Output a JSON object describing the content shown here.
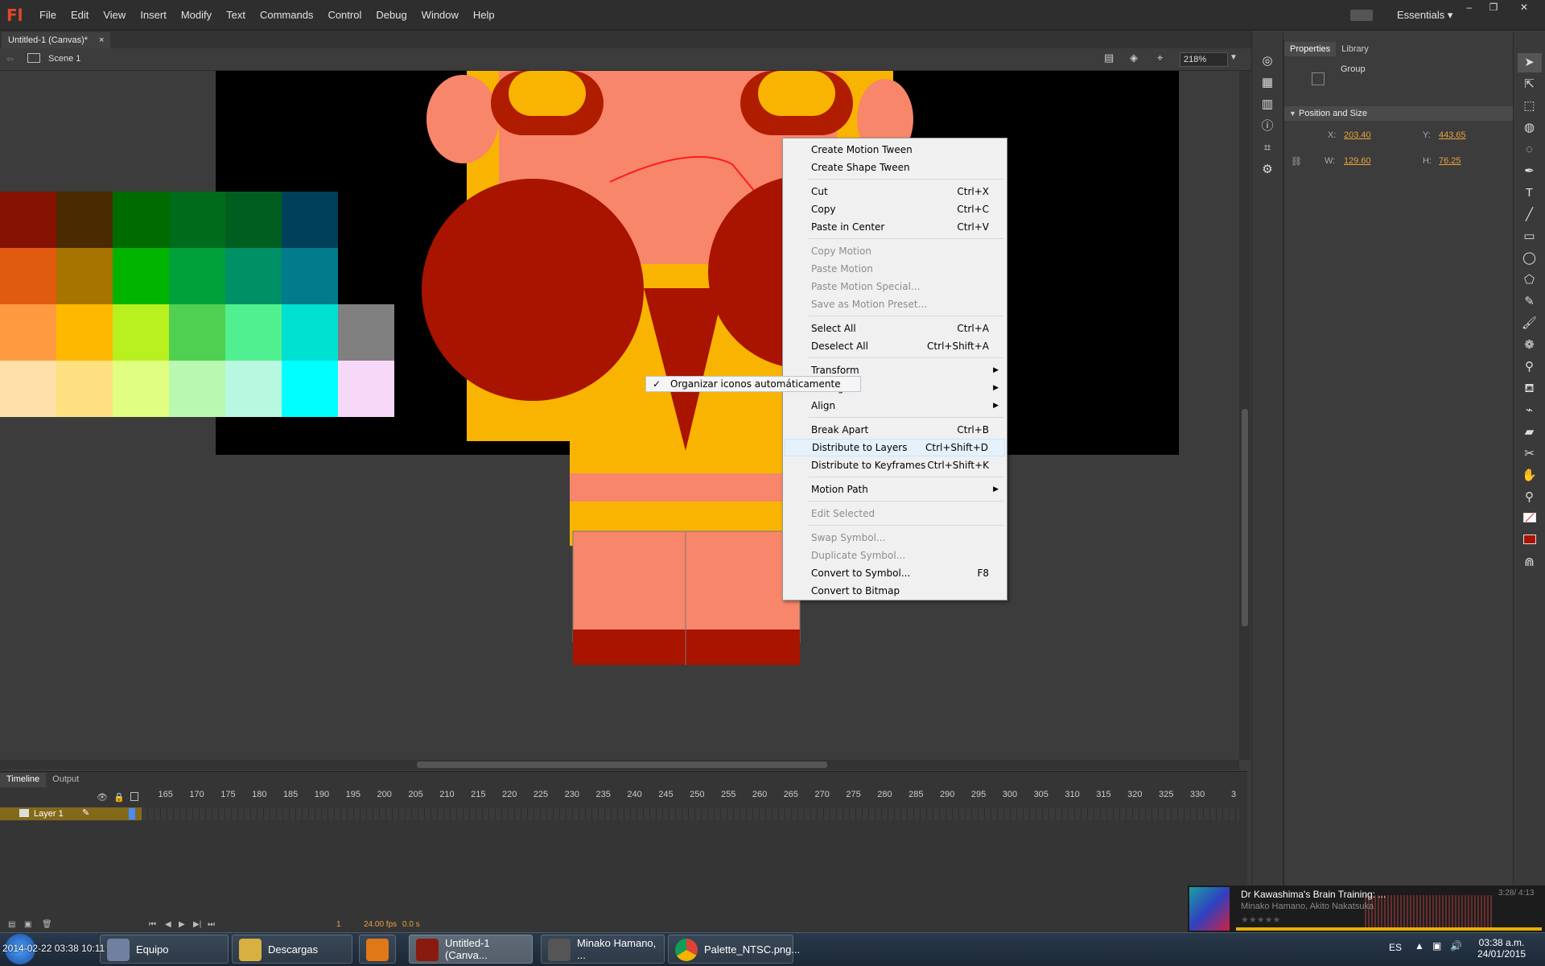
{
  "app": {
    "logo": "Fl",
    "menu": [
      "File",
      "Edit",
      "View",
      "Insert",
      "Modify",
      "Text",
      "Commands",
      "Control",
      "Debug",
      "Window",
      "Help"
    ],
    "workspace": "Essentials",
    "window_buttons": [
      "–",
      "❐",
      "✕"
    ]
  },
  "document": {
    "tab_title": "Untitled-1 (Canvas)*",
    "tab_close": "×",
    "scene": "Scene 1",
    "zoom": "218%"
  },
  "properties": {
    "tabs": [
      "Properties",
      "Library"
    ],
    "instance_type": "Group",
    "section": "Position and Size",
    "x_label": "X:",
    "x_value": "203.40",
    "y_label": "Y:",
    "y_value": "443.65",
    "w_label": "W:",
    "w_value": "129.60",
    "h_label": "H:",
    "h_value": "76.25"
  },
  "timeline": {
    "tabs": [
      "Timeline",
      "Output"
    ],
    "ruler": [
      "165",
      "170",
      "175",
      "180",
      "185",
      "190",
      "195",
      "200",
      "205",
      "210",
      "215",
      "220",
      "225",
      "230",
      "235",
      "240",
      "245",
      "250",
      "255",
      "260",
      "265",
      "270",
      "275",
      "280",
      "285",
      "290",
      "295",
      "300",
      "305",
      "310",
      "315",
      "320",
      "325",
      "330",
      "3"
    ],
    "layer_name": "Layer 1",
    "current_frame": "1",
    "fps": "24.00 fps",
    "time": "0.0 s"
  },
  "context_menu": {
    "groups": [
      [
        {
          "label": "Create Motion Tween",
          "shortcut": ""
        },
        {
          "label": "Create Shape Tween",
          "shortcut": ""
        }
      ],
      [
        {
          "label": "Cut",
          "shortcut": "Ctrl+X"
        },
        {
          "label": "Copy",
          "shortcut": "Ctrl+C"
        },
        {
          "label": "Paste in Center",
          "shortcut": "Ctrl+V"
        }
      ],
      [
        {
          "label": "Copy Motion",
          "shortcut": "",
          "disabled": true
        },
        {
          "label": "Paste Motion",
          "shortcut": "",
          "disabled": true
        },
        {
          "label": "Paste Motion Special...",
          "shortcut": "",
          "disabled": true
        },
        {
          "label": "Save as Motion Preset...",
          "shortcut": "",
          "disabled": true
        }
      ],
      [
        {
          "label": "Select All",
          "shortcut": "Ctrl+A"
        },
        {
          "label": "Deselect All",
          "shortcut": "Ctrl+Shift+A"
        }
      ],
      [
        {
          "label": "Transform",
          "shortcut": "",
          "submenu": true
        },
        {
          "label": "Arrange",
          "shortcut": "",
          "submenu": true
        },
        {
          "label": "Align",
          "shortcut": "",
          "submenu": true
        }
      ],
      [
        {
          "label": "Break Apart",
          "shortcut": "Ctrl+B"
        },
        {
          "label": "Distribute to Layers",
          "shortcut": "Ctrl+Shift+D",
          "hover": true
        },
        {
          "label": "Distribute to Keyframes",
          "shortcut": "Ctrl+Shift+K"
        }
      ],
      [
        {
          "label": "Motion Path",
          "shortcut": "",
          "submenu": true
        }
      ],
      [
        {
          "label": "Edit Selected",
          "shortcut": "",
          "disabled": true
        }
      ],
      [
        {
          "label": "Swap Symbol...",
          "shortcut": "",
          "disabled": true
        },
        {
          "label": "Duplicate Symbol...",
          "shortcut": "",
          "disabled": true
        },
        {
          "label": "Convert to Symbol...",
          "shortcut": "F8"
        },
        {
          "label": "Convert to Bitmap",
          "shortcut": ""
        }
      ]
    ]
  },
  "overlay_tooltip": {
    "check": "✓",
    "text": "Organizar iconos automáticamente"
  },
  "palette": {
    "rows": [
      [
        "#851200",
        "#4a2a00",
        "#006b00",
        "#006b1a",
        "#005e20",
        "#00405a"
      ],
      [
        "#e05a10",
        "#a87400",
        "#00b400",
        "#00a03a",
        "#009066",
        "#007c8c"
      ],
      [
        "#ff9a40",
        "#ffb800",
        "#b8f020",
        "#50d050",
        "#50f090",
        "#00e0d0",
        "#808080"
      ],
      [
        "#ffe0a8",
        "#ffe080",
        "#e0ff80",
        "#b8f8b0",
        "#b8f8e0",
        "#00ffff",
        "#f8d8f8"
      ]
    ]
  },
  "taskbar": {
    "items": [
      "Equipo",
      "Descargas",
      "",
      "Untitled-1 (Canva...",
      "Minako Hamano, ...",
      "Palette_NTSC.png..."
    ],
    "overlay_text": "2014-02-22 03:38 10:11",
    "lang": "ES",
    "clock_time": "03:38 a.m.",
    "clock_date": "24/01/2015"
  },
  "music": {
    "title": "Dr Kawashima's Brain Training: ...",
    "artist": "Minako Hamano, Akito Nakatsuka",
    "time": "3:28/ 4:13",
    "rating": "★★★★★"
  }
}
